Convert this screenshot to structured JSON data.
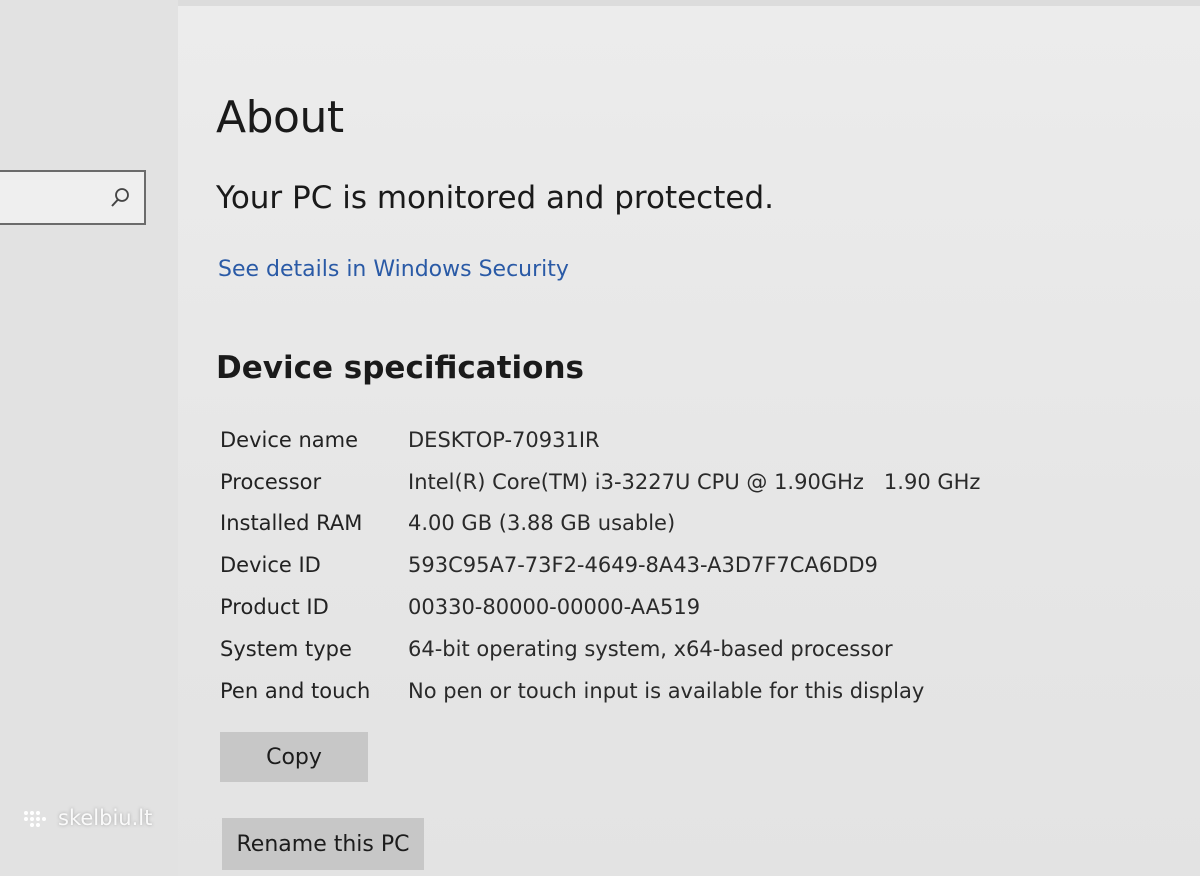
{
  "page": {
    "title": "About",
    "protection_status": "Your PC is monitored and protected.",
    "security_link": "See details in Windows Security"
  },
  "search": {
    "icon": "search-icon"
  },
  "device_specs": {
    "heading": "Device specifications",
    "rows": [
      {
        "label": "Device name",
        "value": "DESKTOP-70931IR"
      },
      {
        "label": "Processor",
        "value": "Intel(R) Core(TM) i3-3227U CPU @ 1.90GHz   1.90 GHz"
      },
      {
        "label": "Installed RAM",
        "value": "4.00 GB (3.88 GB usable)"
      },
      {
        "label": "Device ID",
        "value": "593C95A7-73F2-4649-8A43-A3D7F7CA6DD9"
      },
      {
        "label": "Product ID",
        "value": "00330-80000-00000-AA519"
      },
      {
        "label": "System type",
        "value": "64-bit operating system, x64-based processor"
      },
      {
        "label": "Pen and touch",
        "value": "No pen or touch input is available for this display"
      }
    ]
  },
  "buttons": {
    "copy_label": "Copy",
    "rename_label": "Rename this PC"
  },
  "watermark": {
    "text": "skelbiu.lt"
  },
  "colors": {
    "link": "#2a5aa6",
    "button": "#c7c7c7",
    "background": "#e9e9e9"
  }
}
